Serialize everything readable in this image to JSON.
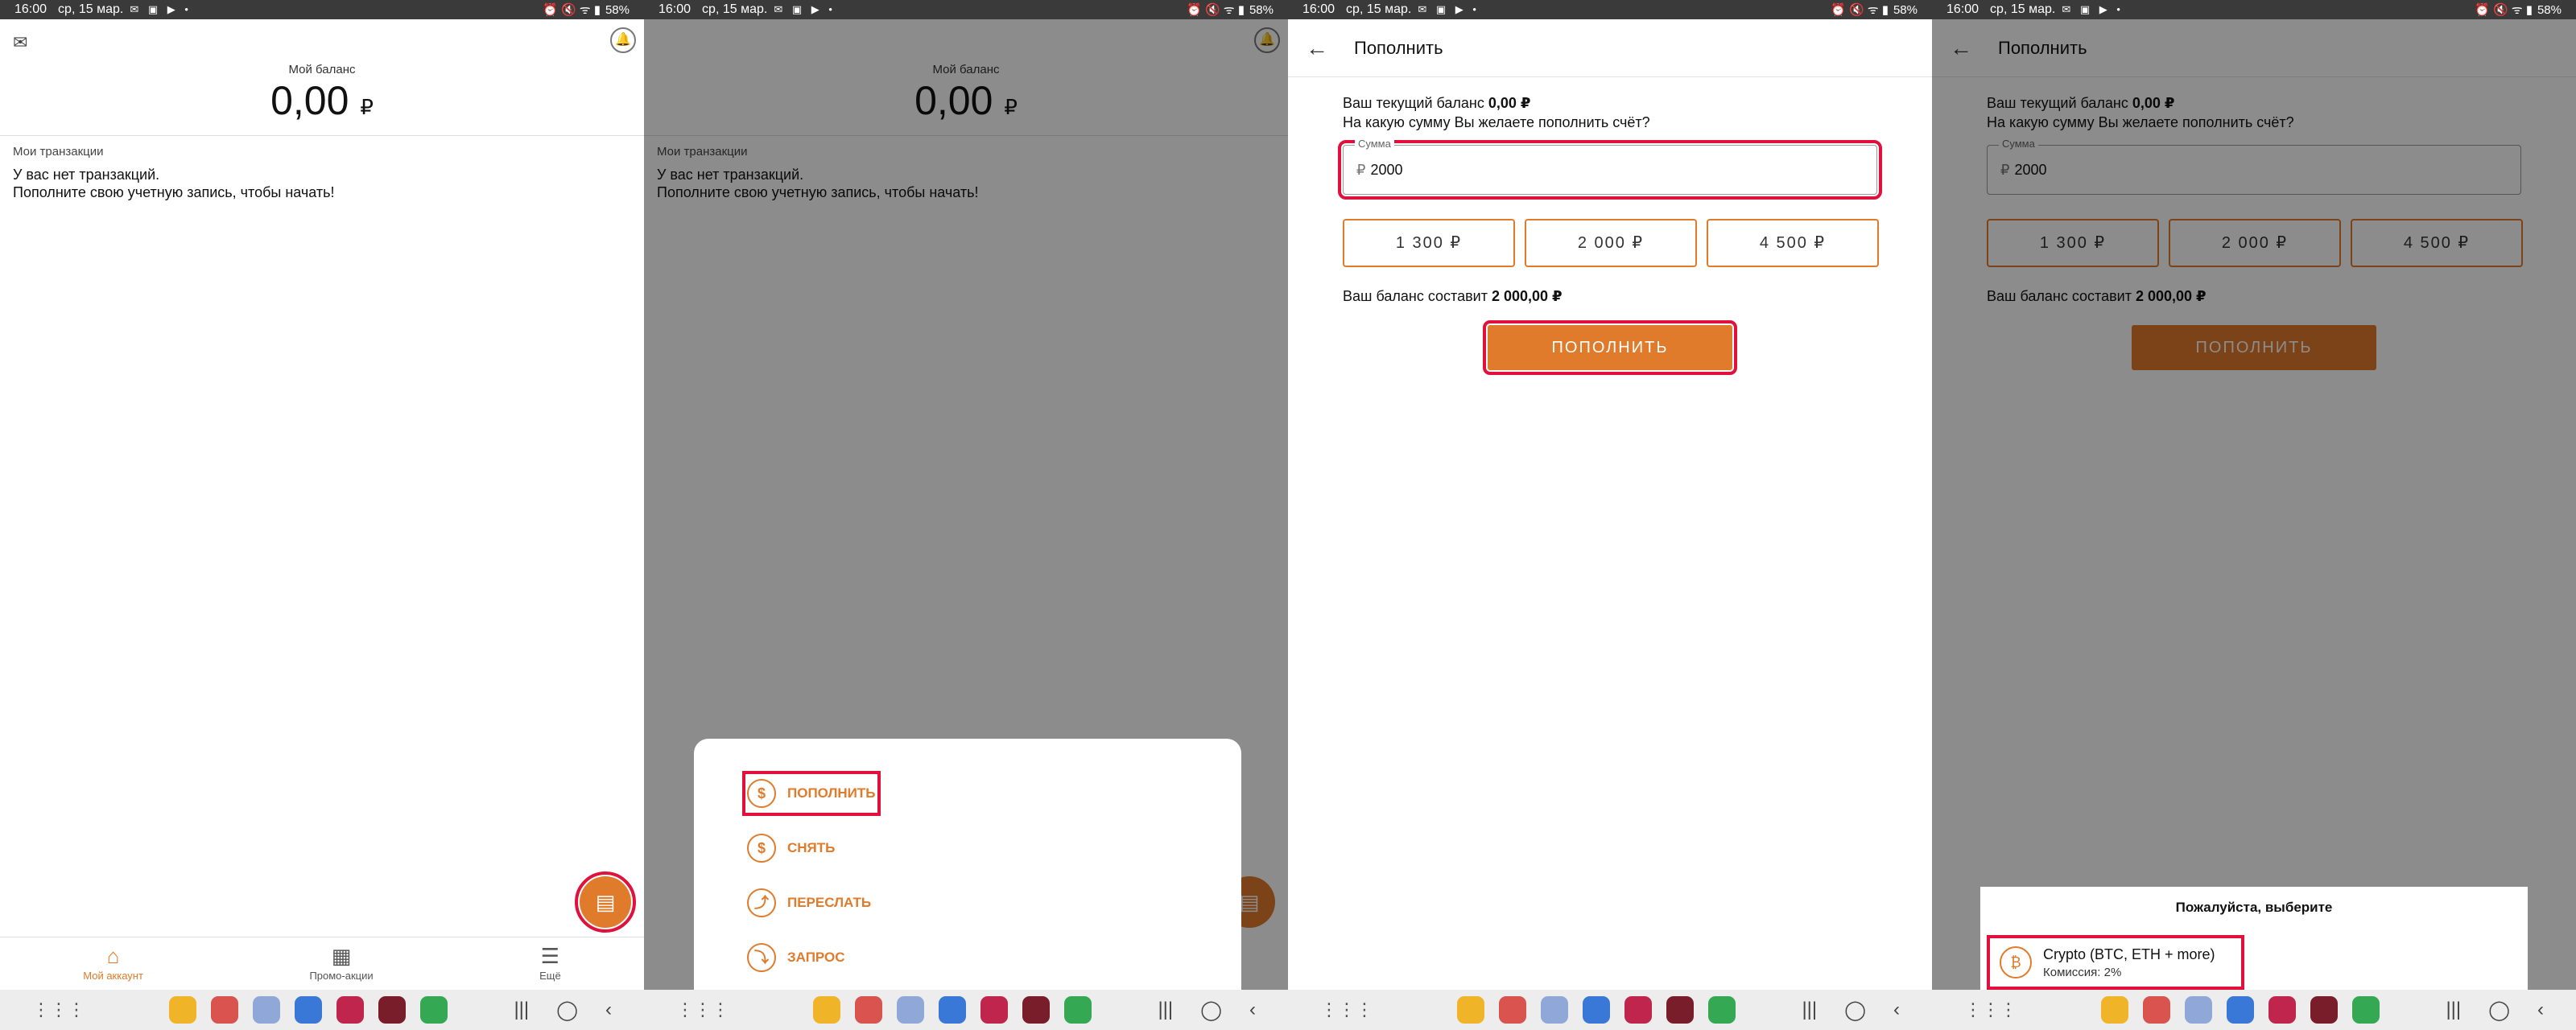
{
  "status": {
    "time": "16:00",
    "date": "ср, 15 мар.",
    "battery": "58%",
    "icons": "✉ ▣ ▶ •",
    "right_icons": "⏰ 🔇 ᯤ ▮"
  },
  "nav": {
    "apps_icon": "⋮⋮⋮",
    "recent_icon": "|||",
    "home_icon": "◯",
    "back_icon": "‹"
  },
  "dock_colors": [
    "#f0b429",
    "#d9534f",
    "#8fa8d8",
    "#3a78d8",
    "#c0264d",
    "#7a1d2a",
    "#34a853"
  ],
  "home": {
    "mail_icon": "✉",
    "bell_icon": "🔔",
    "balance_label": "Мой баланс",
    "balance_value": "0,00",
    "currency": "₽",
    "transactions_title": "Мои транзакции",
    "empty_line1": "У вас нет транзакций.",
    "empty_line2": "Пополните свою учетную запись, чтобы начать!",
    "fab_icon": "▤",
    "bottom_nav": [
      {
        "label": "Мой аккаунт",
        "icon": "⌂"
      },
      {
        "label": "Промо-акции",
        "icon": "▦"
      },
      {
        "label": "Ещё",
        "icon": "☰"
      }
    ]
  },
  "actions": [
    {
      "label": "ПОПОЛНИТЬ",
      "icon": "$"
    },
    {
      "label": "СНЯТЬ",
      "icon": "$"
    },
    {
      "label": "ПЕРЕСЛАТЬ",
      "icon": "⤴"
    },
    {
      "label": "ЗАПРОС",
      "icon": "⤵"
    }
  ],
  "topup": {
    "back_icon": "←",
    "title": "Пополнить",
    "current_prefix": "Ваш текущий баланс ",
    "current_value": "0,00 ₽",
    "question": "На какую сумму Вы желаете пополнить счёт?",
    "field_label": "Сумма",
    "field_currency": "₽",
    "field_value": "2000",
    "presets": [
      "1 300 ₽",
      "2 000 ₽",
      "4 500 ₽"
    ],
    "result_prefix": "Ваш баланс составит ",
    "result_value": "2 000,00 ₽",
    "submit": "ПОПОЛНИТЬ"
  },
  "chooser": {
    "title": "Пожалуйста, выберите",
    "method_name": "Crypto (BTC, ETH + more)",
    "method_fee": "Комиссия: 2%",
    "method_icon": "₿"
  }
}
